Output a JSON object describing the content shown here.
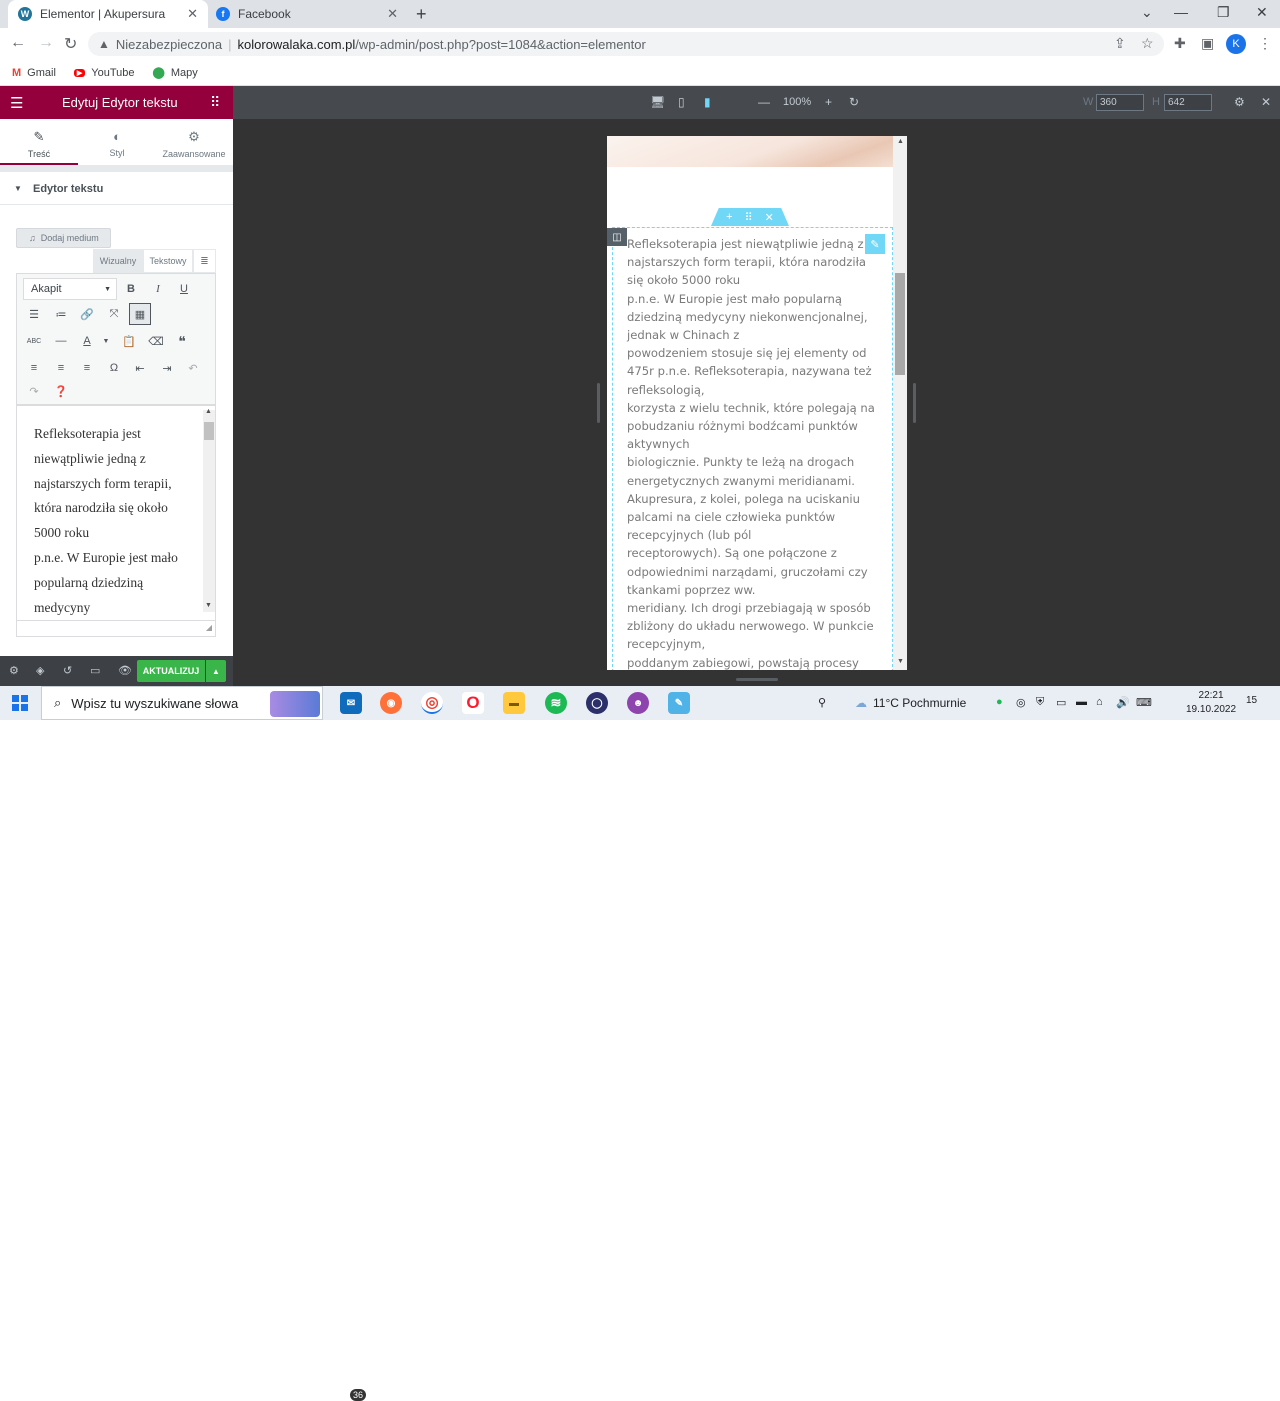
{
  "browser": {
    "tabs": [
      {
        "title": "Elementor | Akupersura",
        "icon": "wordpress-icon"
      },
      {
        "title": "Facebook",
        "icon": "facebook-icon"
      }
    ],
    "address": {
      "security": "Niezabezpieczona",
      "domain": "kolorowalaka.com.pl",
      "path": "/wp-admin/post.php?post=1084&action=elementor"
    },
    "profile_initial": "K",
    "bookmarks": [
      {
        "label": "Gmail",
        "icon": "gmail-icon"
      },
      {
        "label": "YouTube",
        "icon": "youtube-icon"
      },
      {
        "label": "Mapy",
        "icon": "maps-icon"
      }
    ]
  },
  "panel": {
    "header_title": "Edytuj Edytor tekstu",
    "tabs": [
      {
        "label": "Treść",
        "icon": "pencil-icon"
      },
      {
        "label": "Styl",
        "icon": "contrast-icon"
      },
      {
        "label": "Zaawansowane",
        "icon": "gear-icon"
      }
    ],
    "section_title": "Edytor tekstu",
    "add_media": "Dodaj medium",
    "editor_tab_visual": "Wizualny",
    "editor_tab_text": "Tekstowy",
    "format_select": "Akapit",
    "editor_content": "Refleksoterapia jest niewątpliwie jedną z najstarszych form terapii, która narodziła się około 5000 roku\np.n.e. W Europie jest mało popularną dziedziną medycyny",
    "update_button": "AKTUALIZUJ"
  },
  "preview": {
    "zoom": "100%",
    "width_label": "W",
    "width_value": "360",
    "height_label": "H",
    "height_value": "642",
    "widget_text": "Refleksoterapia jest niewątpliwie jedną z najstarszych form terapii, która narodziła się około 5000 roku\np.n.e. W Europie jest mało popularną dziedziną medycyny niekonwencjonalnej, jednak w Chinach z\npowodzeniem stosuje się jej elementy od 475r p.n.e. Refleksoterapia, nazywana też refleksologią,\nkorzysta z wielu technik, które polegają na pobudzaniu różnymi bodźcami punktów aktywnych\nbiologicznie. Punkty te leżą na drogach energetycznych zwanymi meridianami. Akupresura, z kolei, polega na uciskaniu palcami na ciele człowieka punktów recepcyjnych (lub pól\nreceptorowych). Są one połączone z odpowiednimi narządami, gruczołami czy tkankami poprzez ww.\nmeridiany. Ich drogi przebiagają w sposób zbliżony do układu nerwowego. W punkcie recepcyjnym,\npoddanym zabiegowi, powstają procesy"
  },
  "taskbar": {
    "search_placeholder": "Wpisz tu wyszukiwane słowa",
    "mail_badge": "36",
    "weather": "11°C  Pochmurnie",
    "time": "22:21",
    "date": "19.10.2022",
    "notifications": "15"
  },
  "colors": {
    "elementor_brand": "#93003c",
    "elementor_accent": "#71d7f7",
    "update_green": "#39b54a"
  }
}
